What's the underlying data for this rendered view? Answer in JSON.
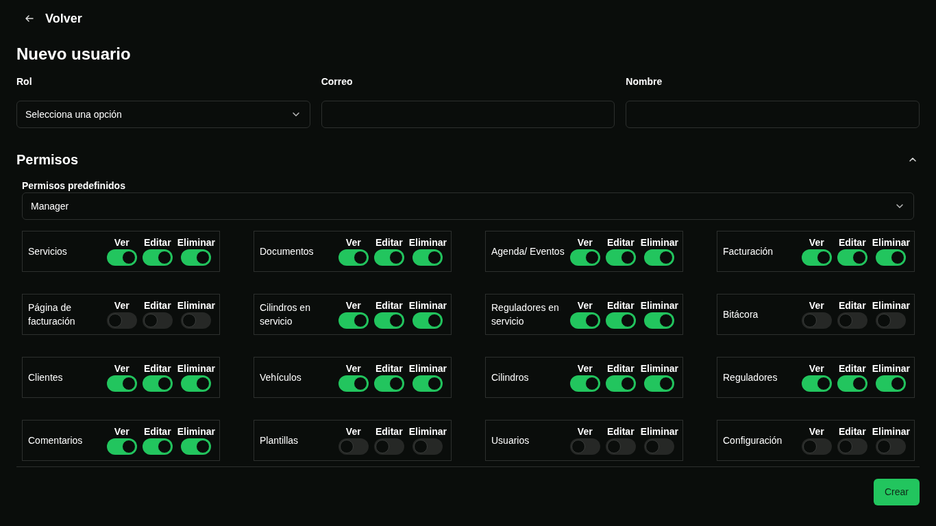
{
  "back": {
    "label": "Volver"
  },
  "title": "Nuevo usuario",
  "fields": [
    {
      "kind": "select",
      "label": "Rol",
      "value": "Selecciona una opción"
    },
    {
      "kind": "text",
      "label": "Correo"
    },
    {
      "kind": "text",
      "label": "Nombre"
    }
  ],
  "permissions": {
    "title": "Permisos",
    "expanded": true,
    "preset_label": "Permisos predefinidos",
    "preset_value": "Manager",
    "modules": [
      {
        "name": "Servicios",
        "toggles": [
          {
            "label": "Ver",
            "on": true
          },
          {
            "label": "Editar",
            "on": true
          },
          {
            "label": "Eliminar",
            "on": true
          }
        ]
      },
      {
        "name": "Documentos",
        "toggles": [
          {
            "label": "Ver",
            "on": true
          },
          {
            "label": "Editar",
            "on": true
          },
          {
            "label": "Eliminar",
            "on": true
          }
        ]
      },
      {
        "name": "Agenda/ Eventos",
        "toggles": [
          {
            "label": "Ver",
            "on": true
          },
          {
            "label": "Editar",
            "on": true
          },
          {
            "label": "Eliminar",
            "on": true
          }
        ]
      },
      {
        "name": "Facturación",
        "toggles": [
          {
            "label": "Ver",
            "on": true
          },
          {
            "label": "Editar",
            "on": true
          },
          {
            "label": "Eliminar",
            "on": true
          }
        ]
      },
      {
        "name": "Página de facturación",
        "toggles": [
          {
            "label": "Ver",
            "on": false
          },
          {
            "label": "Editar",
            "on": false
          },
          {
            "label": "Eliminar",
            "on": false
          }
        ]
      },
      {
        "name": "Cilindros en servicio",
        "toggles": [
          {
            "label": "Ver",
            "on": true
          },
          {
            "label": "Editar",
            "on": true
          },
          {
            "label": "Eliminar",
            "on": true
          }
        ]
      },
      {
        "name": "Reguladores en servicio",
        "toggles": [
          {
            "label": "Ver",
            "on": true
          },
          {
            "label": "Editar",
            "on": true
          },
          {
            "label": "Eliminar",
            "on": true
          }
        ]
      },
      {
        "name": "Bitácora",
        "toggles": [
          {
            "label": "Ver",
            "on": false
          },
          {
            "label": "Editar",
            "on": false
          },
          {
            "label": "Eliminar",
            "on": false
          }
        ]
      },
      {
        "name": "Clientes",
        "toggles": [
          {
            "label": "Ver",
            "on": true
          },
          {
            "label": "Editar",
            "on": true
          },
          {
            "label": "Eliminar",
            "on": true
          }
        ]
      },
      {
        "name": "Vehículos",
        "toggles": [
          {
            "label": "Ver",
            "on": true
          },
          {
            "label": "Editar",
            "on": true
          },
          {
            "label": "Eliminar",
            "on": true
          }
        ]
      },
      {
        "name": "Cilindros",
        "toggles": [
          {
            "label": "Ver",
            "on": true
          },
          {
            "label": "Editar",
            "on": true
          },
          {
            "label": "Eliminar",
            "on": true
          }
        ]
      },
      {
        "name": "Reguladores",
        "toggles": [
          {
            "label": "Ver",
            "on": true
          },
          {
            "label": "Editar",
            "on": true
          },
          {
            "label": "Eliminar",
            "on": true
          }
        ]
      },
      {
        "name": "Comentarios",
        "toggles": [
          {
            "label": "Ver",
            "on": true
          },
          {
            "label": "Editar",
            "on": true
          },
          {
            "label": "Eliminar",
            "on": true
          }
        ]
      },
      {
        "name": "Plantillas",
        "toggles": [
          {
            "label": "Ver",
            "on": false
          },
          {
            "label": "Editar",
            "on": false
          },
          {
            "label": "Eliminar",
            "on": false
          }
        ]
      },
      {
        "name": "Usuarios",
        "toggles": [
          {
            "label": "Ver",
            "on": false
          },
          {
            "label": "Editar",
            "on": false
          },
          {
            "label": "Eliminar",
            "on": false
          }
        ]
      },
      {
        "name": "Configuración",
        "toggles": [
          {
            "label": "Ver",
            "on": false
          },
          {
            "label": "Editar",
            "on": false
          },
          {
            "label": "Eliminar",
            "on": false
          }
        ]
      }
    ]
  },
  "submit": {
    "label": "Crear"
  }
}
